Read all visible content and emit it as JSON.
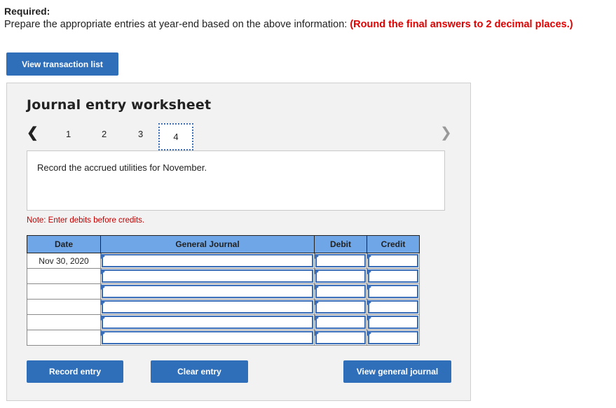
{
  "required": {
    "title": "Required:",
    "instruction": "Prepare the appropriate entries at year-end based on the above information:",
    "emphasis": "(Round the final answers to 2 decimal places.)"
  },
  "buttons": {
    "view_transactions": "View transaction list",
    "record_entry": "Record entry",
    "clear_entry": "Clear entry",
    "view_general_journal": "View general journal"
  },
  "worksheet": {
    "title": "Journal entry worksheet",
    "pages": [
      "1",
      "2",
      "3",
      "4"
    ],
    "active_page": "4",
    "description": "Record the accrued utilities for November.",
    "note": "Note: Enter debits before credits."
  },
  "table": {
    "headers": {
      "date": "Date",
      "journal": "General Journal",
      "debit": "Debit",
      "credit": "Credit"
    },
    "rows": [
      {
        "date": "Nov 30, 2020",
        "account": "",
        "debit": "",
        "credit": ""
      },
      {
        "date": "",
        "account": "",
        "debit": "",
        "credit": ""
      },
      {
        "date": "",
        "account": "",
        "debit": "",
        "credit": ""
      },
      {
        "date": "",
        "account": "",
        "debit": "",
        "credit": ""
      },
      {
        "date": "",
        "account": "",
        "debit": "",
        "credit": ""
      },
      {
        "date": "",
        "account": "",
        "debit": "",
        "credit": ""
      }
    ]
  },
  "colors": {
    "button_blue": "#2f6fba",
    "header_blue": "#6ea6e8",
    "emphasis_red": "#e00000"
  }
}
